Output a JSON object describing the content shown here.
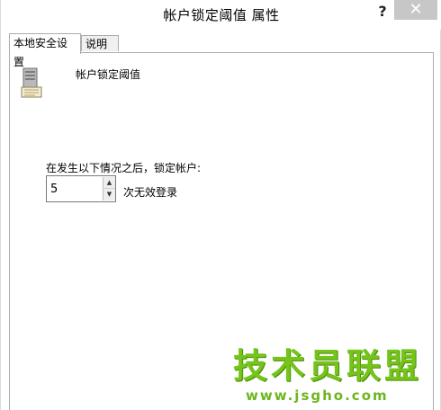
{
  "window": {
    "title": "帐户锁定阈值 属性",
    "help_label": "?",
    "close_label": "✕"
  },
  "tabs": [
    {
      "label": "本地安全设置",
      "active": true
    },
    {
      "label": "说明",
      "active": false
    }
  ],
  "policy": {
    "icon": "server-policy-icon",
    "name": "帐户锁定阈值"
  },
  "lockout": {
    "label": "在发生以下情况之后，锁定帐户:",
    "value": "5",
    "spin_up": "▲",
    "spin_down": "▼",
    "unit_label": "次无效登录"
  },
  "watermark": {
    "main": "技术员联盟",
    "url": "www.jsgho.com"
  },
  "colors": {
    "close_button": "#c7c7c7",
    "watermark_green": "#74c41a",
    "border": "#acacac"
  }
}
